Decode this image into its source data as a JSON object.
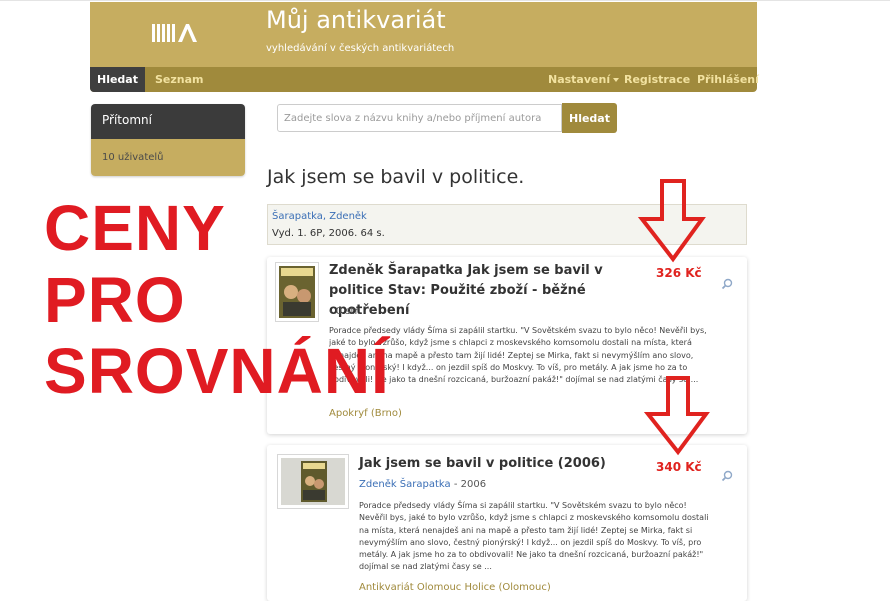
{
  "header": {
    "title": "Můj antikvariát",
    "subtitle": "vyhledávání v českých antikvariátech"
  },
  "nav": {
    "search": "Hledat",
    "list": "Seznam",
    "settings": "Nastavení",
    "register": "Registrace",
    "login": "Přihlášení"
  },
  "sidebar": {
    "heading": "Přítomní",
    "users": "10 uživatelů"
  },
  "search": {
    "placeholder": "Zadejte slova z názvu knihy a/nebo příjmení autora",
    "button": "Hledat"
  },
  "book": {
    "title": "Jak jsem se bavil v politice.",
    "author": "Šarapatka, Zdeněk",
    "details": "Vyd. 1. 6P, 2006. 64 s."
  },
  "overlay": {
    "lines": [
      "CENY",
      "PRO",
      "SROVNÁNÍ"
    ],
    "color": "#e01b22"
  },
  "listings": [
    {
      "title": "Zdeněk Šarapatka Jak jsem se bavil v politice Stav: Použité zboží - běžné opotřebení",
      "meta": "- 0 str.",
      "description": "Poradce předsedy vlády Šíma si zapálil startku. \"V Sovětském svazu to bylo něco! Nevěřil bys, jaké to bylo vzrůšo, když jsme s chlapci z moskevského komsomolu dostali na místa, která nenajdeš ani na mapě a přesto tam žijí lidé! Zeptej se Mirka, fakt si nevymýšlím ano slovo, čestný pionýrský! I když... on jezdil spíš do Moskvy. To víš, pro metály. A jak jsme ho za to obdivovali! Ne jako ta dnešní rozcicaná, buržoazní pakáž!\" dojímal se nad zlatými časy se ...",
      "seller": "Apokryf (Brno)",
      "price": "326 Kč"
    },
    {
      "title": "Jak jsem se bavil v politice (2006)",
      "author": "Zdeněk Šarapatka",
      "year": "- 2006",
      "description": "Poradce předsedy vlády Šíma si zapálil startku. \"V Sovětském svazu to bylo něco! Nevěřil bys, jaké to bylo vzrůšo, když jsme s chlapci z moskevského komsomolu dostali na místa, která nenajdeš ani na mapě a přesto tam žijí lidé! Zeptej se Mirka, fakt si nevymýšlím ano slovo, čestný pionýrský! I když... on jezdil spíš do Moskvy. To víš, pro metály. A jak jsme ho za to obdivovali! Ne jako ta dnešní rozcicaná, buržoazní pakáž!\" dojímal se nad zlatými časy se ...",
      "seller": "Antikvariát Olomouc Holice (Olomouc)",
      "price": "340 Kč"
    }
  ],
  "icons": {
    "logo": "logo-icon",
    "zoom": "zoom-icon",
    "arrow": "arrow-down-icon",
    "caret": "caret-down-icon"
  },
  "colors": {
    "brand": "#c6ad60",
    "nav": "#a08a3c",
    "nav_active": "#3f3f3f",
    "link": "#3b6fb6",
    "price": "#e0231f"
  }
}
